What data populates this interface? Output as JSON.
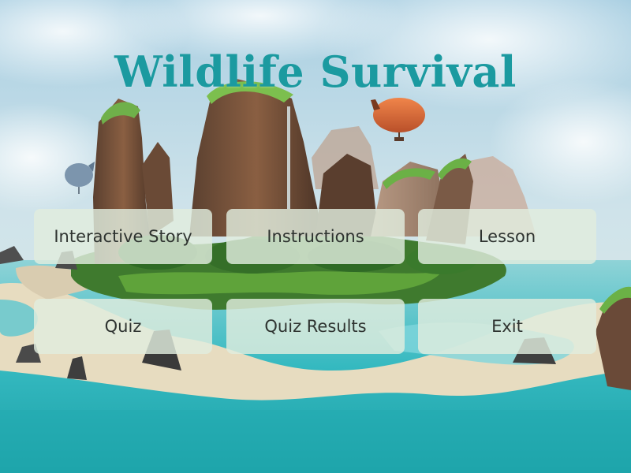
{
  "title": "Wildlife Survival",
  "menu": {
    "interactive_story": "Interactive Story",
    "instructions": "Instructions",
    "lesson": "Lesson",
    "quiz": "Quiz",
    "quiz_results": "Quiz Results",
    "exit": "Exit"
  },
  "colors": {
    "title": "#1b9aa0",
    "button_bg": "#e1edde",
    "button_text": "#2e3330"
  }
}
